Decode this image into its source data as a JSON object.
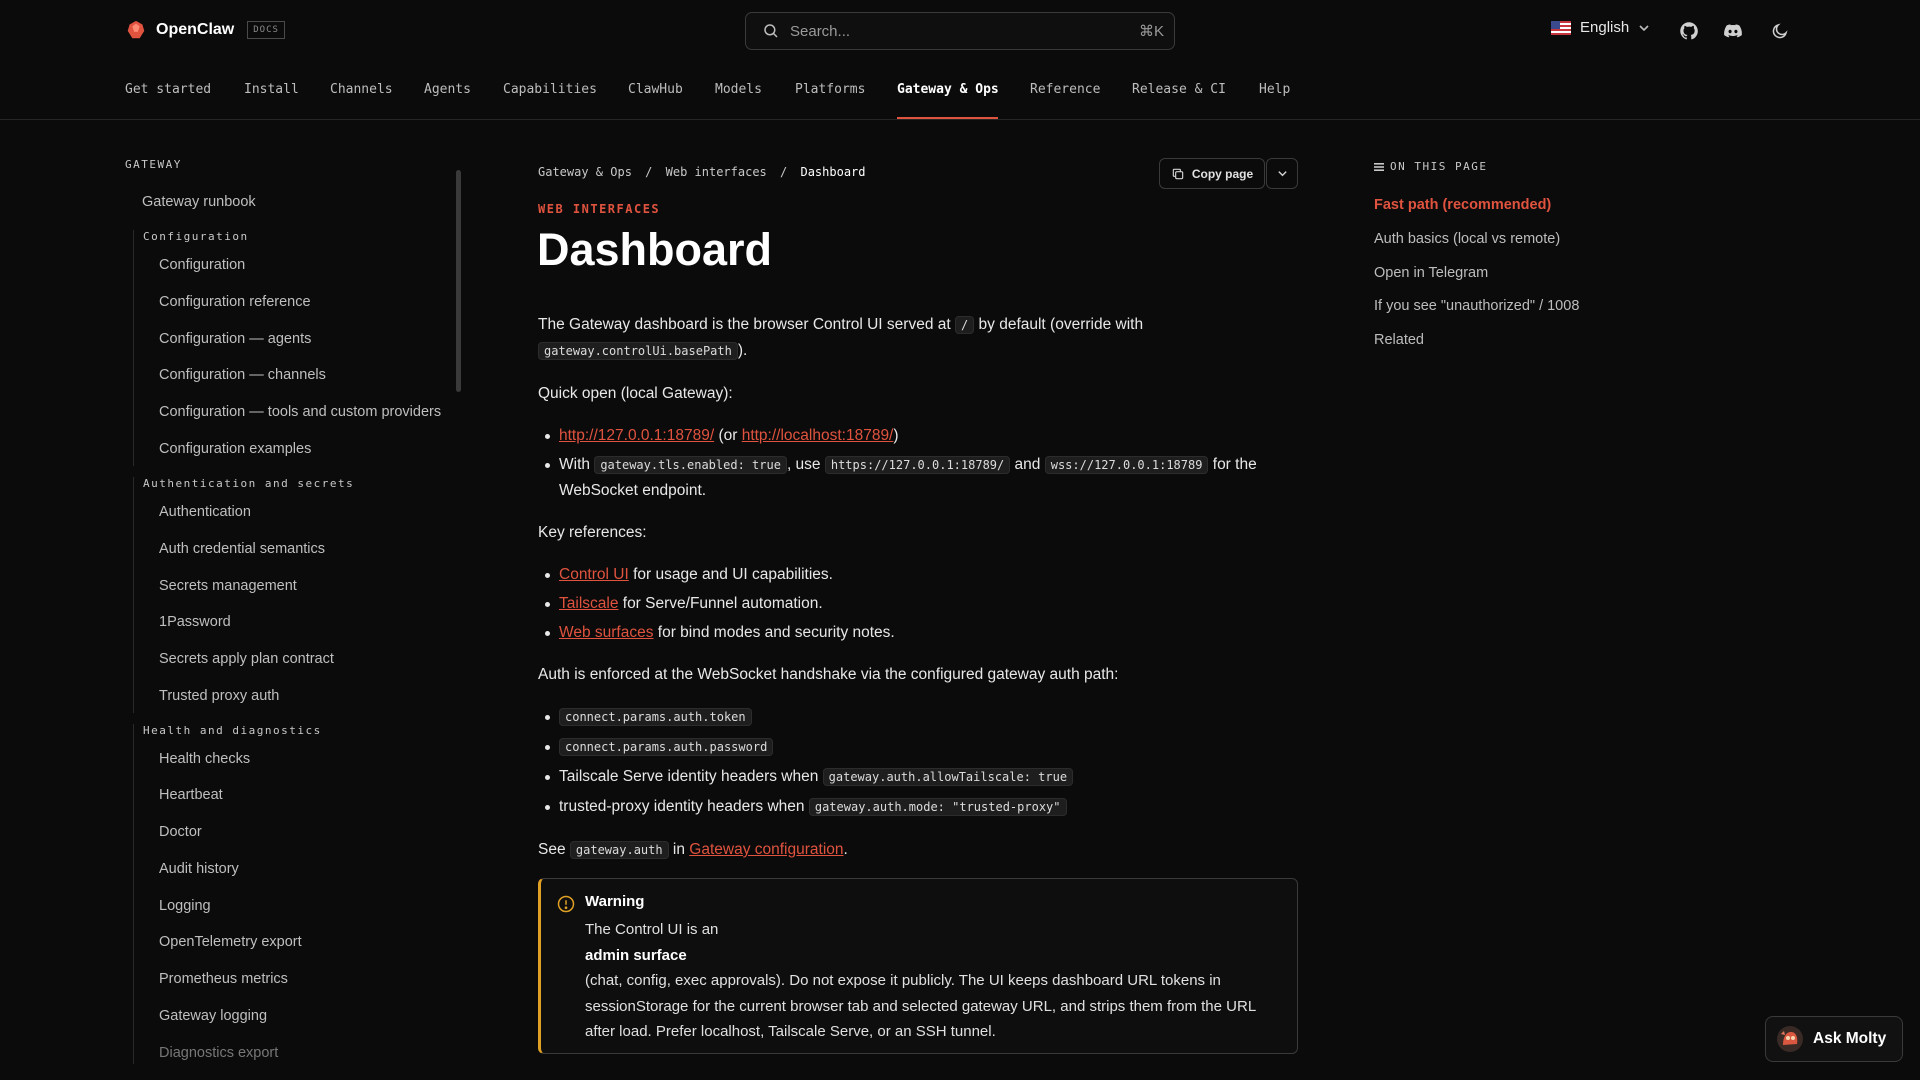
{
  "brand": {
    "name": "OpenClaw",
    "badge": "DOCS"
  },
  "search": {
    "placeholder": "Search...",
    "shortcut": "⌘K"
  },
  "language": {
    "label": "English"
  },
  "nav": {
    "tabs": [
      {
        "label": "Get started"
      },
      {
        "label": "Install"
      },
      {
        "label": "Channels"
      },
      {
        "label": "Agents"
      },
      {
        "label": "Capabilities"
      },
      {
        "label": "ClawHub"
      },
      {
        "label": "Models"
      },
      {
        "label": "Platforms"
      },
      {
        "label": "Gateway & Ops"
      },
      {
        "label": "Reference"
      },
      {
        "label": "Release & CI"
      },
      {
        "label": "Help"
      }
    ],
    "active_index": 8
  },
  "sidebar": {
    "section": "GATEWAY",
    "top_item": "Gateway runbook",
    "groups": [
      {
        "title": "Configuration",
        "items": [
          "Configuration",
          "Configuration reference",
          "Configuration — agents",
          "Configuration — channels",
          "Configuration — tools and custom providers",
          "Configuration examples"
        ]
      },
      {
        "title": "Authentication and secrets",
        "items": [
          "Authentication",
          "Auth credential semantics",
          "Secrets management",
          "1Password",
          "Secrets apply plan contract",
          "Trusted proxy auth"
        ]
      },
      {
        "title": "Health and diagnostics",
        "items": [
          "Health checks",
          "Heartbeat",
          "Doctor",
          "Audit history",
          "Logging",
          "OpenTelemetry export",
          "Prometheus metrics",
          "Gateway logging",
          "Diagnostics export"
        ]
      }
    ]
  },
  "breadcrumb": {
    "items": [
      "Gateway & Ops",
      "Web interfaces",
      "Dashboard"
    ],
    "separator": "/"
  },
  "page_actions": {
    "copy_label": "Copy page"
  },
  "article": {
    "eyebrow": "WEB INTERFACES",
    "title": "Dashboard",
    "intro_a": "The Gateway dashboard is the browser Control UI served at ",
    "intro_code1": "/",
    "intro_b": " by default (override with ",
    "intro_code2": "gateway.controlUi.basePath",
    "intro_c": ").",
    "quick_open": "Quick open (local Gateway):",
    "qo_link1": "http://127.0.0.1:18789/",
    "qo_text1": " (or ",
    "qo_link2": "http://localhost:18789/",
    "qo_text2": ")",
    "tls_a": "With ",
    "tls_code1": "gateway.tls.enabled: true",
    "tls_b": ", use ",
    "tls_code2": "https://127.0.0.1:18789/",
    "tls_c": " and ",
    "tls_code3": "wss://127.0.0.1:18789",
    "tls_d": " for the WebSocket endpoint.",
    "key_refs": "Key references:",
    "ref1_link": "Control UI",
    "ref1_text": " for usage and UI capabilities.",
    "ref2_link": "Tailscale",
    "ref2_text": " for Serve/Funnel automation.",
    "ref3_link": "Web surfaces",
    "ref3_text": " for bind modes and security notes.",
    "auth_intro": "Auth is enforced at the WebSocket handshake via the configured gateway auth path:",
    "auth1_code": "connect.params.auth.token",
    "auth2_code": "connect.params.auth.password",
    "auth3_text": "Tailscale Serve identity headers when ",
    "auth3_code": "gateway.auth.allowTailscale: true",
    "auth4_text": "trusted-proxy identity headers when ",
    "auth4_code": "gateway.auth.mode: \"trusted-proxy\"",
    "see_a": "See ",
    "see_code": "gateway.auth",
    "see_b": " in ",
    "see_link": "Gateway configuration",
    "see_c": "."
  },
  "warning": {
    "title": "Warning",
    "line1": "The Control UI is an",
    "bold": "admin surface",
    "line3": "(chat, config, exec approvals). Do not expose it publicly. The UI keeps dashboard URL tokens in sessionStorage for the current browser tab and selected gateway URL, and strips them from the URL after load. Prefer localhost, Tailscale Serve, or an SSH tunnel.",
    "accent": "#e0a024"
  },
  "toc": {
    "heading": "ON THIS PAGE",
    "items": [
      "Fast path (recommended)",
      "Auth basics (local vs remote)",
      "Open in Telegram",
      "If you see \"unauthorized\" / 1008",
      "Related"
    ],
    "active_index": 0
  },
  "assistant": {
    "label": "Ask Molty"
  },
  "colors": {
    "accent": "#e0533f",
    "background": "#0b0b0b",
    "warning": "#e0a024"
  },
  "icons": [
    "openclaw-logo-icon",
    "search-icon",
    "us-flag-icon",
    "chevron-down-icon",
    "github-icon",
    "discord-icon",
    "moon-icon",
    "copy-icon",
    "warning-icon",
    "list-icon",
    "molty-avatar-icon"
  ]
}
